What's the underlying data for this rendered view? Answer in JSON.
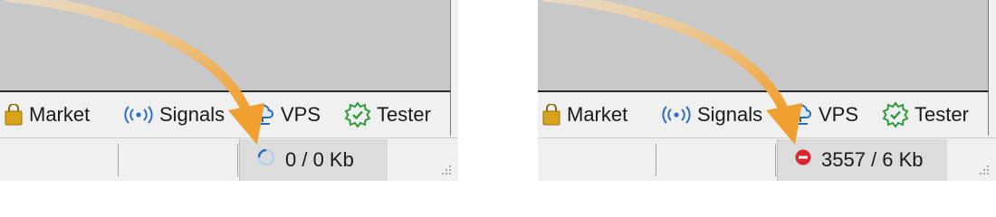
{
  "panels": [
    {
      "toolbar": {
        "market_label": "Market",
        "signals_label": "Signals",
        "vps_label": "VPS",
        "tester_label": "Tester"
      },
      "status": {
        "traffic_text": "0 / 0 Kb",
        "connection_icon": "connecting-spinner-icon"
      }
    },
    {
      "toolbar": {
        "market_label": "Market",
        "signals_label": "Signals",
        "vps_label": "VPS",
        "tester_label": "Tester"
      },
      "status": {
        "traffic_text": "3557 / 6 Kb",
        "connection_icon": "no-connection-icon"
      }
    }
  ],
  "colors": {
    "arrow": "#f0a030",
    "workspace": "#c8c8c8",
    "signals_blue": "#2b6fc2",
    "vps_blue": "#2a6db5",
    "tester_green": "#2e9b3a",
    "error_red": "#d9262d",
    "market_gold": "#d8a21a"
  }
}
